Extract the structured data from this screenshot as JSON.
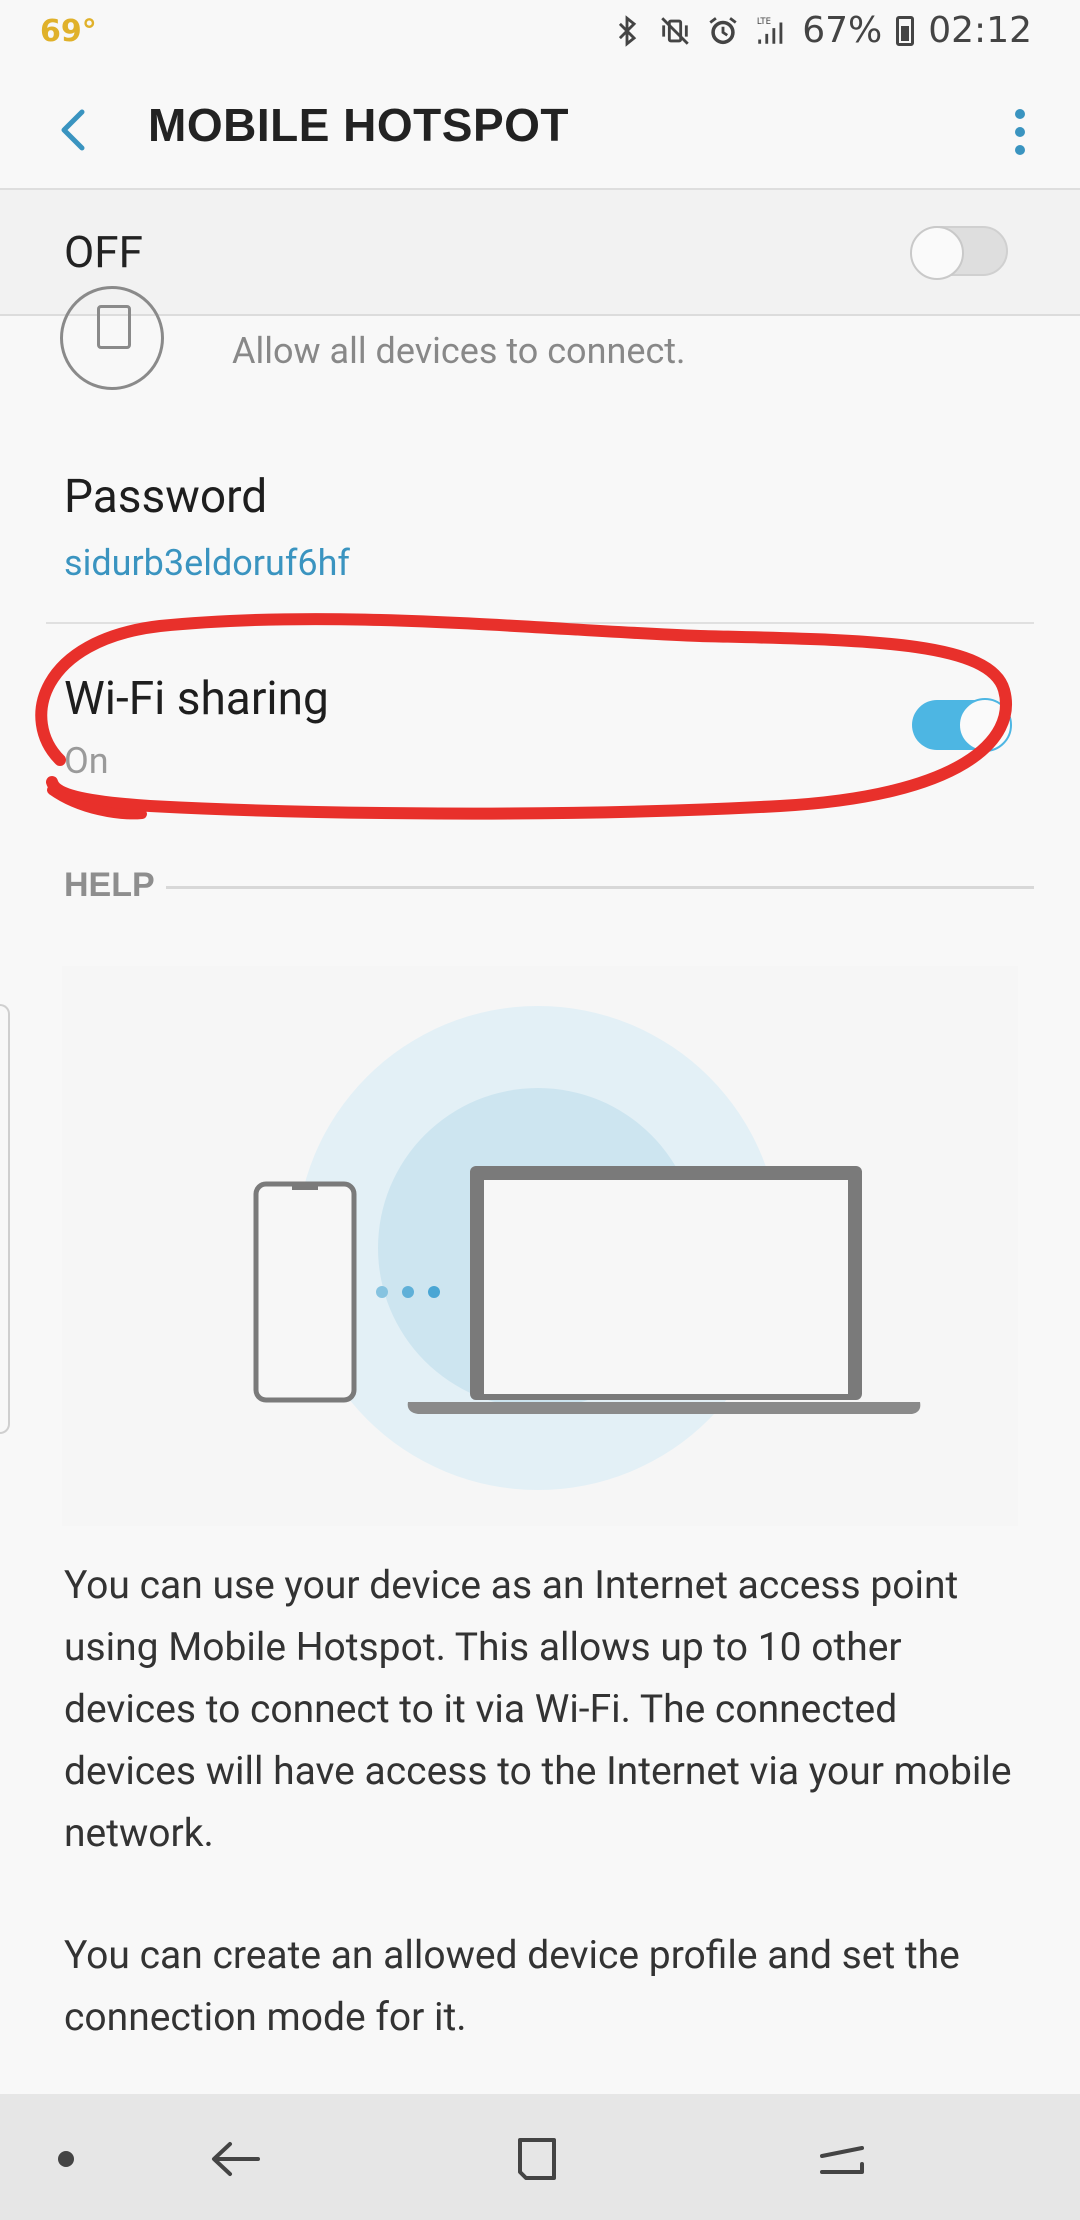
{
  "status_bar": {
    "temperature": "69°",
    "battery_percent": "67%",
    "time": "02:12",
    "network": "LTE",
    "icons": [
      "bluetooth-icon",
      "vibrate-mute-icon",
      "alarm-icon",
      "signal-icon",
      "battery-icon"
    ]
  },
  "header": {
    "title": "MOBILE HOTSPOT",
    "back_icon": "chevron-left-icon",
    "more_icon": "more-vertical-icon",
    "accent_color": "#3a94c0"
  },
  "master_switch": {
    "label": "OFF",
    "state": false
  },
  "list": {
    "allowed_devices_subtitle": "Allow all devices to connect.",
    "password_title": "Password",
    "password_value": "sidurb3eldoruf6hf",
    "wifi_sharing_title": "Wi-Fi sharing",
    "wifi_sharing_status": "On",
    "wifi_sharing_enabled": true,
    "toggle_on_color": "#4db6e3"
  },
  "help": {
    "heading": "HELP",
    "paragraph_1": "You can use your device as an Internet access point using Mobile Hotspot. This allows up to 10 other devices to connect to it via Wi-Fi. The connected devices will have access to the Internet via your mobile network.",
    "paragraph_2": "You can create an allowed device profile and set the connection mode for it.",
    "illustration_icons": [
      "phone-icon",
      "laptop-icon"
    ]
  },
  "annotation": {
    "color": "#e8302b"
  },
  "nav_bar": {
    "items": [
      "dot-icon",
      "back-arrow-icon",
      "home-square-icon",
      "recents-icon"
    ]
  }
}
